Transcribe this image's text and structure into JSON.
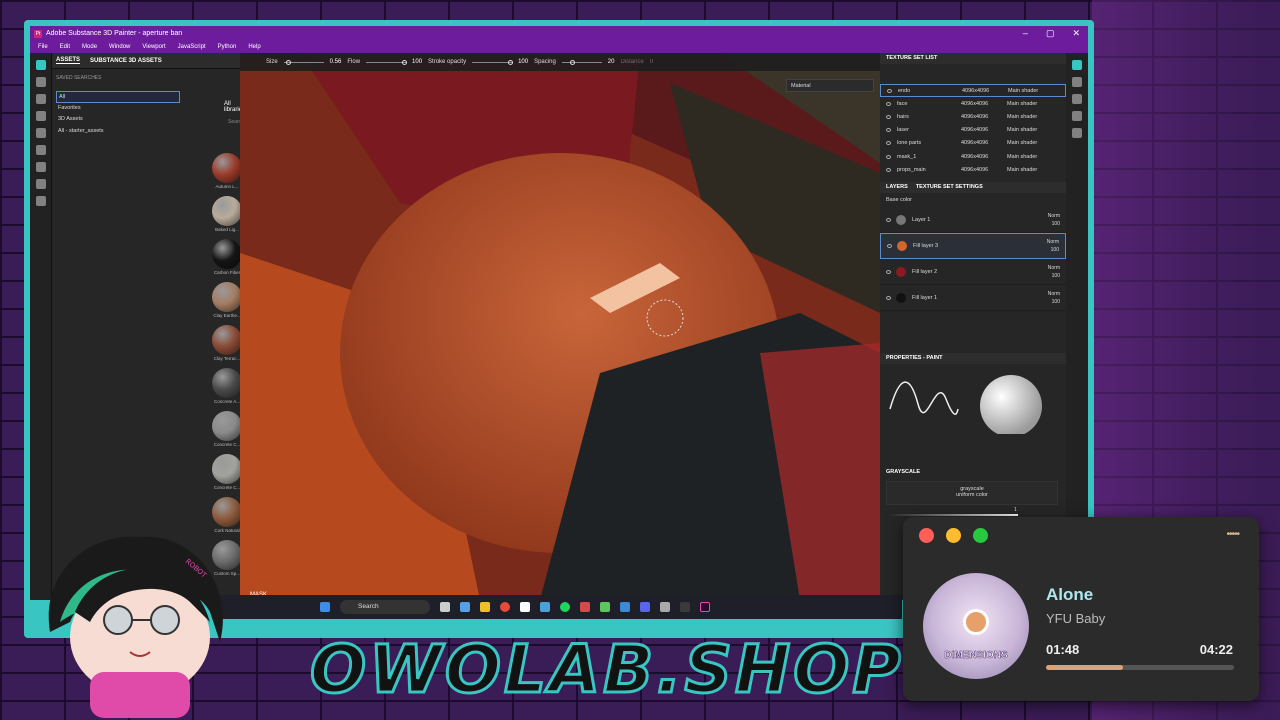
{
  "window": {
    "title": "Adobe Substance 3D Painter - aperture ban",
    "logo": "Pt",
    "controls": [
      "–",
      "▢",
      "✕"
    ]
  },
  "menu": [
    "File",
    "Edit",
    "Mode",
    "Window",
    "Viewport",
    "JavaScript",
    "Python",
    "Help"
  ],
  "assets": {
    "tabs": [
      "ASSETS",
      "SUBSTANCE 3D ASSETS"
    ],
    "saved_searches": "SAVED SEARCHES",
    "libraries": [
      "All",
      "Favorites",
      "3D Assets",
      "All - starter_assets"
    ],
    "all_libraries": "All librarie",
    "search_placeholder": "Search",
    "materials": [
      {
        "name": "Autumn L...",
        "color": "#9b3b2a"
      },
      {
        "name": "Baked Lig...",
        "color": "#b9ab9a"
      },
      {
        "name": "Carbon Fiber",
        "color": "#151515"
      },
      {
        "name": "Clay Earthe...",
        "color": "#a57c63"
      },
      {
        "name": "Clay Terrac...",
        "color": "#8a4a36"
      },
      {
        "name": "Concrete A...",
        "color": "#4a4a4a"
      },
      {
        "name": "Concrete C...",
        "color": "#8a8a8a"
      },
      {
        "name": "Concrete C...",
        "color": "#a2a29e"
      },
      {
        "name": "Cork Natural",
        "color": "#8d5a3c"
      },
      {
        "name": "Custom Sp...",
        "color": "#6b6b6b"
      }
    ]
  },
  "toolbar": {
    "size_label": "Size",
    "size_value": "0.56",
    "flow_label": "Flow",
    "flow_value": "100",
    "stroke_label": "Stroke opacity",
    "stroke_value": "100",
    "spacing_label": "Spacing",
    "spacing_value": "20",
    "distance_label": "Distance",
    "distance_value": "0"
  },
  "viewport": {
    "material_dropdown": "Material",
    "mask_label": "MASK"
  },
  "texture_sets": {
    "title": "TEXTURE SET LIST",
    "items": [
      {
        "name": "endo",
        "res": "4096x4096",
        "shader": "Main shader"
      },
      {
        "name": "face",
        "res": "4096x4096",
        "shader": "Main shader"
      },
      {
        "name": "hairs",
        "res": "4096x4096",
        "shader": "Main shader"
      },
      {
        "name": "laser",
        "res": "4096x4096",
        "shader": "Main shader"
      },
      {
        "name": "lone parts",
        "res": "4096x4096",
        "shader": "Main shader"
      },
      {
        "name": "mask_1",
        "res": "4096x4096",
        "shader": "Main shader"
      },
      {
        "name": "props_main",
        "res": "4096x4096",
        "shader": "Main shader"
      }
    ]
  },
  "layers": {
    "tabs": [
      "LAYERS",
      "TEXTURE SET SETTINGS"
    ],
    "channel": "Base color",
    "items": [
      {
        "name": "Layer 1",
        "blend": "Norm",
        "opacity": "100",
        "color": "#777777"
      },
      {
        "name": "Fill layer 3",
        "blend": "Norm",
        "opacity": "100",
        "color": "#d5652a"
      },
      {
        "name": "Fill layer 2",
        "blend": "Norm",
        "opacity": "100",
        "color": "#8c1a22"
      },
      {
        "name": "Fill layer 1",
        "blend": "Norm",
        "opacity": "100",
        "color": "#111111"
      }
    ]
  },
  "properties": {
    "title": "PROPERTIES - PAINT",
    "section": "GRAYSCALE",
    "gray_name": "grayscale",
    "gray_type": "uniform color",
    "gray_value": "1"
  },
  "taskbar": {
    "search": "Search"
  },
  "brand": "OWOLAB.SHOP",
  "music": {
    "song": "Alone",
    "artist": "YFU Baby",
    "current": "01:48",
    "total": "04:22",
    "progress": 0.41,
    "cover_text": "DIMENSIONS",
    "dots": "•••••"
  },
  "mascot_badge": "ROBOT"
}
